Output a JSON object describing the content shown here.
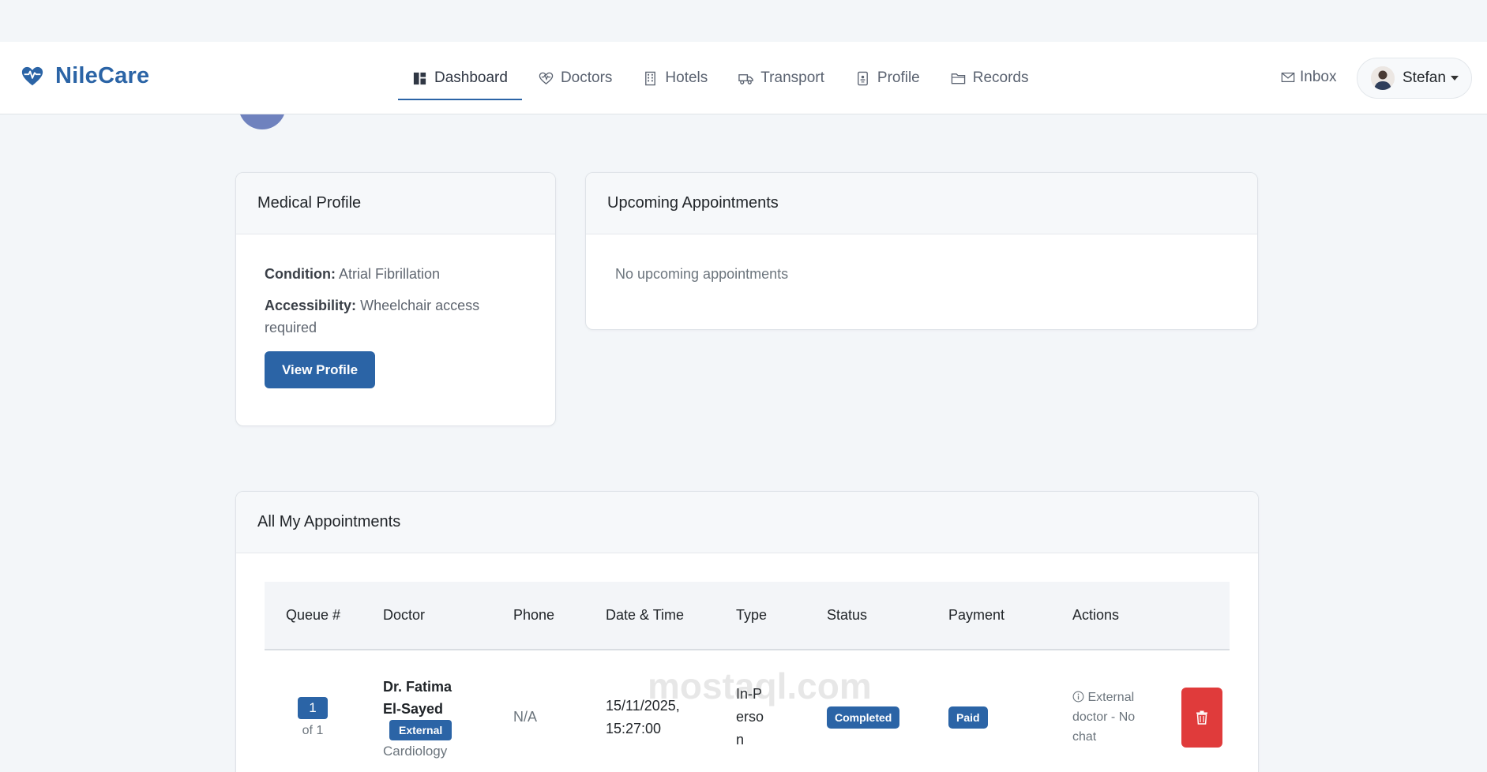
{
  "brand": {
    "name": "NileCare",
    "icon": "heart-pulse-icon",
    "color": "#2b64a6"
  },
  "nav": {
    "items": [
      {
        "label": "Dashboard",
        "icon": "dashboard-icon",
        "active": true
      },
      {
        "label": "Doctors",
        "icon": "heart-pulse-icon"
      },
      {
        "label": "Hotels",
        "icon": "building-icon"
      },
      {
        "label": "Transport",
        "icon": "truck-icon"
      },
      {
        "label": "Profile",
        "icon": "id-card-icon"
      },
      {
        "label": "Records",
        "icon": "folder-icon"
      }
    ],
    "inbox_label": "Inbox",
    "user_name": "Stefan"
  },
  "medical_profile": {
    "title": "Medical Profile",
    "condition_label": "Condition:",
    "condition_value": "Atrial Fibrillation",
    "accessibility_label": "Accessibility:",
    "accessibility_value": "Wheelchair access required",
    "button_label": "View Profile"
  },
  "upcoming": {
    "title": "Upcoming Appointments",
    "empty_text": "No upcoming appointments"
  },
  "appointments": {
    "title": "All My Appointments",
    "columns": [
      "Queue #",
      "Doctor",
      "Phone",
      "Date & Time",
      "Type",
      "Status",
      "Payment",
      "Actions"
    ],
    "rows": [
      {
        "queue": "1",
        "queue_of": "of 1",
        "doctor": "Dr. Fatima El-Sayed",
        "doctor_badge": "External",
        "specialty": "Cardiology",
        "phone": "N/A",
        "datetime": "15/11/2025, 15:27:00",
        "type": "In-Person",
        "status": "Completed",
        "payment": "Paid",
        "action_note": "External doctor - No chat"
      }
    ]
  },
  "colors": {
    "primary": "#2b64a6",
    "danger": "#e03b3b",
    "background": "#f3f6f9"
  },
  "watermark": "mostaql.com"
}
